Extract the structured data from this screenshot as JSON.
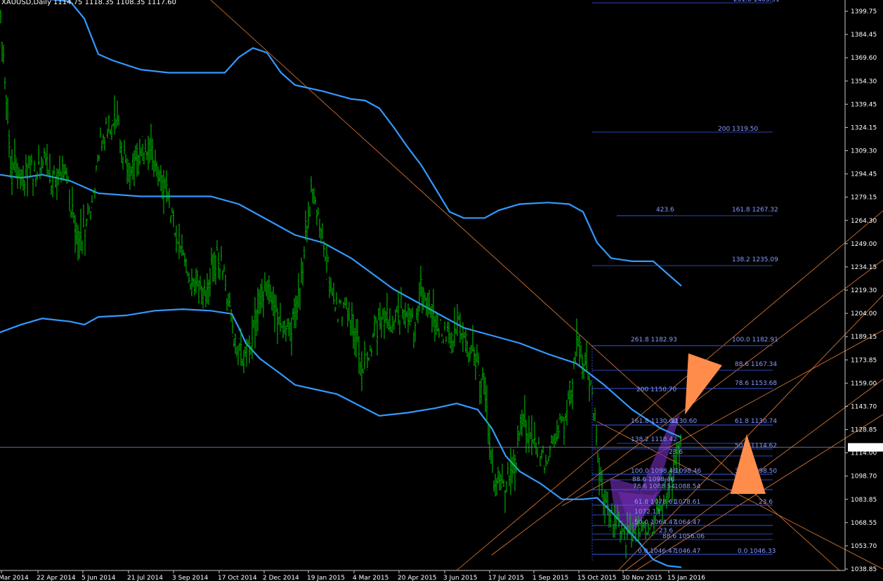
{
  "title": "XAUUSD,Daily  1114.75 1118.35 1108.35 1117.60",
  "colors": {
    "background": "#000000",
    "candles": "#00c800",
    "bands": "#3399ff",
    "trendlines": "#ff8c40",
    "fibo": "#3a5cf0",
    "fibo_text": "#8899ff",
    "pattern_fill": "#6a2aa6",
    "arrow": "#ff8c4a",
    "current_price_line": "#8d96c8",
    "axis_text": "#ffffff"
  },
  "chart_data": {
    "type": "line",
    "symbol": "XAUUSD",
    "timeframe": "Daily",
    "ohlc_last": {
      "open": 1114.75,
      "high": 1118.35,
      "low": 1108.35,
      "close": 1117.6
    },
    "current_price_label": "1117.60",
    "ylim": [
      1034,
      1412
    ],
    "y_ticks": [
      "1399.75",
      "1384.45",
      "1369.60",
      "1354.30",
      "1339.45",
      "1324.15",
      "1309.30",
      "1294.45",
      "1279.15",
      "1264.30",
      "1249.00",
      "1234.15",
      "1219.30",
      "1204.00",
      "1189.15",
      "1173.85",
      "1159.00",
      "1143.70",
      "1128.85",
      "1114.00",
      "1098.70",
      "1083.85",
      "1068.55",
      "1053.70",
      "1038.85"
    ],
    "x_ticks": [
      "Mar 2014",
      "22 Apr 2014",
      "5 Jun 2014",
      "21 Jul 2014",
      "3 Sep 2014",
      "17 Oct 2014",
      "2 Dec 2014",
      "19 Jan 2015",
      "4 Mar 2015",
      "20 Apr 2015",
      "3 Jun 2015",
      "17 Jul 2015",
      "1 Sep 2015",
      "15 Oct 2015",
      "30 Nov 2015",
      "15 Jan 2016"
    ],
    "price_path": [
      [
        0,
        1400
      ],
      [
        6,
        1360
      ],
      [
        12,
        1320
      ],
      [
        18,
        1295
      ],
      [
        26,
        1300
      ],
      [
        34,
        1290
      ],
      [
        44,
        1300
      ],
      [
        52,
        1290
      ],
      [
        60,
        1305
      ],
      [
        70,
        1295
      ],
      [
        80,
        1290
      ],
      [
        90,
        1300
      ],
      [
        100,
        1280
      ],
      [
        108,
        1250
      ],
      [
        116,
        1250
      ],
      [
        124,
        1265
      ],
      [
        132,
        1280
      ],
      [
        140,
        1310
      ],
      [
        148,
        1320
      ],
      [
        156,
        1325
      ],
      [
        164,
        1330
      ],
      [
        172,
        1315
      ],
      [
        180,
        1300
      ],
      [
        188,
        1295
      ],
      [
        196,
        1300
      ],
      [
        204,
        1310
      ],
      [
        212,
        1315
      ],
      [
        220,
        1300
      ],
      [
        228,
        1290
      ],
      [
        236,
        1285
      ],
      [
        244,
        1270
      ],
      [
        252,
        1255
      ],
      [
        260,
        1245
      ],
      [
        268,
        1230
      ],
      [
        276,
        1225
      ],
      [
        284,
        1220
      ],
      [
        292,
        1215
      ],
      [
        300,
        1230
      ],
      [
        308,
        1240
      ],
      [
        316,
        1235
      ],
      [
        324,
        1215
      ],
      [
        332,
        1190
      ],
      [
        340,
        1180
      ],
      [
        348,
        1175
      ],
      [
        356,
        1185
      ],
      [
        364,
        1200
      ],
      [
        372,
        1210
      ],
      [
        380,
        1225
      ],
      [
        388,
        1215
      ],
      [
        396,
        1200
      ],
      [
        404,
        1195
      ],
      [
        412,
        1190
      ],
      [
        420,
        1205
      ],
      [
        428,
        1220
      ],
      [
        436,
        1255
      ],
      [
        444,
        1285
      ],
      [
        452,
        1270
      ],
      [
        460,
        1255
      ],
      [
        468,
        1230
      ],
      [
        476,
        1210
      ],
      [
        484,
        1205
      ],
      [
        492,
        1210
      ],
      [
        500,
        1200
      ],
      [
        508,
        1185
      ],
      [
        516,
        1165
      ],
      [
        524,
        1175
      ],
      [
        532,
        1190
      ],
      [
        540,
        1200
      ],
      [
        548,
        1205
      ],
      [
        556,
        1195
      ],
      [
        564,
        1200
      ],
      [
        572,
        1205
      ],
      [
        580,
        1200
      ],
      [
        588,
        1195
      ],
      [
        596,
        1210
      ],
      [
        604,
        1220
      ],
      [
        612,
        1210
      ],
      [
        620,
        1200
      ],
      [
        628,
        1195
      ],
      [
        636,
        1190
      ],
      [
        644,
        1185
      ],
      [
        652,
        1200
      ],
      [
        660,
        1185
      ],
      [
        668,
        1180
      ],
      [
        676,
        1175
      ],
      [
        684,
        1165
      ],
      [
        692,
        1150
      ],
      [
        698,
        1110
      ],
      [
        704,
        1095
      ],
      [
        712,
        1090
      ],
      [
        720,
        1095
      ],
      [
        728,
        1100
      ],
      [
        736,
        1115
      ],
      [
        744,
        1140
      ],
      [
        752,
        1125
      ],
      [
        760,
        1120
      ],
      [
        768,
        1115
      ],
      [
        776,
        1110
      ],
      [
        784,
        1120
      ],
      [
        792,
        1125
      ],
      [
        800,
        1135
      ],
      [
        808,
        1140
      ],
      [
        816,
        1165
      ],
      [
        822,
        1185
      ],
      [
        830,
        1175
      ],
      [
        838,
        1165
      ],
      [
        846,
        1140
      ],
      [
        852,
        1110
      ],
      [
        858,
        1085
      ],
      [
        866,
        1075
      ],
      [
        874,
        1070
      ],
      [
        882,
        1065
      ],
      [
        890,
        1060
      ],
      [
        898,
        1062
      ],
      [
        906,
        1070
      ],
      [
        914,
        1065
      ],
      [
        922,
        1062
      ],
      [
        930,
        1070
      ],
      [
        938,
        1080
      ],
      [
        946,
        1085
      ],
      [
        954,
        1095
      ],
      [
        962,
        1105
      ],
      [
        966,
        1120
      ],
      [
        970,
        1117.6
      ]
    ],
    "series": [
      {
        "points": [
          [
            0,
            1294
          ],
          [
            30,
            1292
          ],
          [
            60,
            1294
          ],
          [
            100,
            1290
          ],
          [
            140,
            1282
          ],
          [
            200,
            1280
          ],
          [
            260,
            1280
          ],
          [
            300,
            1280
          ],
          [
            340,
            1275
          ],
          [
            380,
            1265
          ],
          [
            420,
            1255
          ],
          [
            460,
            1250
          ],
          [
            500,
            1240
          ],
          [
            560,
            1220
          ],
          [
            620,
            1205
          ],
          [
            660,
            1195
          ],
          [
            700,
            1190
          ],
          [
            740,
            1185
          ],
          [
            780,
            1178
          ],
          [
            820,
            1172
          ],
          [
            860,
            1158
          ],
          [
            900,
            1142
          ],
          [
            940,
            1130
          ],
          [
            970,
            1124
          ]
        ]
      },
      {
        "points": [
          [
            0,
            1410
          ],
          [
            60,
            1408
          ],
          [
            100,
            1406
          ],
          [
            120,
            1395
          ],
          [
            140,
            1372
          ],
          [
            160,
            1368
          ],
          [
            200,
            1362
          ],
          [
            240,
            1360
          ],
          [
            280,
            1360
          ],
          [
            320,
            1360
          ],
          [
            340,
            1370
          ],
          [
            360,
            1376
          ],
          [
            380,
            1373
          ],
          [
            400,
            1360
          ],
          [
            420,
            1352
          ],
          [
            460,
            1348
          ],
          [
            500,
            1343
          ],
          [
            520,
            1342
          ],
          [
            540,
            1337
          ],
          [
            560,
            1325
          ],
          [
            580,
            1312
          ],
          [
            600,
            1300
          ],
          [
            620,
            1285
          ],
          [
            640,
            1270
          ],
          [
            660,
            1266
          ],
          [
            690,
            1266
          ],
          [
            710,
            1271
          ],
          [
            740,
            1275
          ],
          [
            780,
            1276
          ],
          [
            810,
            1275
          ],
          [
            830,
            1270
          ],
          [
            850,
            1250
          ],
          [
            870,
            1240
          ],
          [
            900,
            1238
          ],
          [
            930,
            1238
          ],
          [
            950,
            1230
          ],
          [
            970,
            1222
          ]
        ]
      },
      {
        "points": [
          [
            0,
            1192
          ],
          [
            30,
            1197
          ],
          [
            60,
            1201
          ],
          [
            100,
            1199
          ],
          [
            120,
            1197
          ],
          [
            140,
            1202
          ],
          [
            180,
            1203
          ],
          [
            220,
            1206
          ],
          [
            260,
            1207
          ],
          [
            300,
            1206
          ],
          [
            330,
            1204
          ],
          [
            340,
            1195
          ],
          [
            350,
            1185
          ],
          [
            370,
            1175
          ],
          [
            400,
            1165
          ],
          [
            420,
            1158
          ],
          [
            450,
            1155
          ],
          [
            480,
            1152
          ],
          [
            510,
            1145
          ],
          [
            540,
            1138
          ],
          [
            580,
            1140
          ],
          [
            620,
            1143
          ],
          [
            650,
            1146
          ],
          [
            680,
            1142
          ],
          [
            700,
            1130
          ],
          [
            720,
            1112
          ],
          [
            740,
            1102
          ],
          [
            770,
            1094
          ],
          [
            800,
            1084
          ],
          [
            830,
            1084
          ],
          [
            850,
            1085
          ],
          [
            870,
            1076
          ],
          [
            890,
            1066
          ],
          [
            910,
            1056
          ],
          [
            930,
            1045
          ],
          [
            950,
            1041
          ],
          [
            970,
            1040
          ]
        ]
      }
    ],
    "fibonacci_levels": [
      {
        "label": "261.8 1403.91"
      },
      {
        "label": "200 1319.50"
      },
      {
        "label": "161.8 1267.32"
      },
      {
        "label": "423.6"
      },
      {
        "label": "138.2 1235.09"
      },
      {
        "label": "261.8 1182.93"
      },
      {
        "label": "100.0 1182.91"
      },
      {
        "label": "88.6 1167.34"
      },
      {
        "label": "78.6 1153.68"
      },
      {
        "label": "200 1150.70"
      },
      {
        "label": "161.8 1130.60"
      },
      {
        "label": "1130.60"
      },
      {
        "label": "61.8 1130.74"
      },
      {
        "label": "138.2 1118.42"
      },
      {
        "label": "50.0 1114.62"
      },
      {
        "label": "23.6"
      },
      {
        "label": "100.0 1098.46"
      },
      {
        "label": "1098.46"
      },
      {
        "label": "38.2 1098.50"
      },
      {
        "label": "88.6 1098.46"
      },
      {
        "label": "78.6 1088.54"
      },
      {
        "label": "1088.54"
      },
      {
        "label": "61.8 1078.61"
      },
      {
        "label": "1078.61"
      },
      {
        "label": "23.6"
      },
      {
        "label": "1072.13"
      },
      {
        "label": "50.0 1064.47"
      },
      {
        "label": "1064.47"
      },
      {
        "label": "23.6"
      },
      {
        "label": "88.6 1056.06"
      },
      {
        "label": "0.0 1046.47"
      },
      {
        "label": "1046.47"
      },
      {
        "label": "0.0 1046.33"
      }
    ]
  }
}
